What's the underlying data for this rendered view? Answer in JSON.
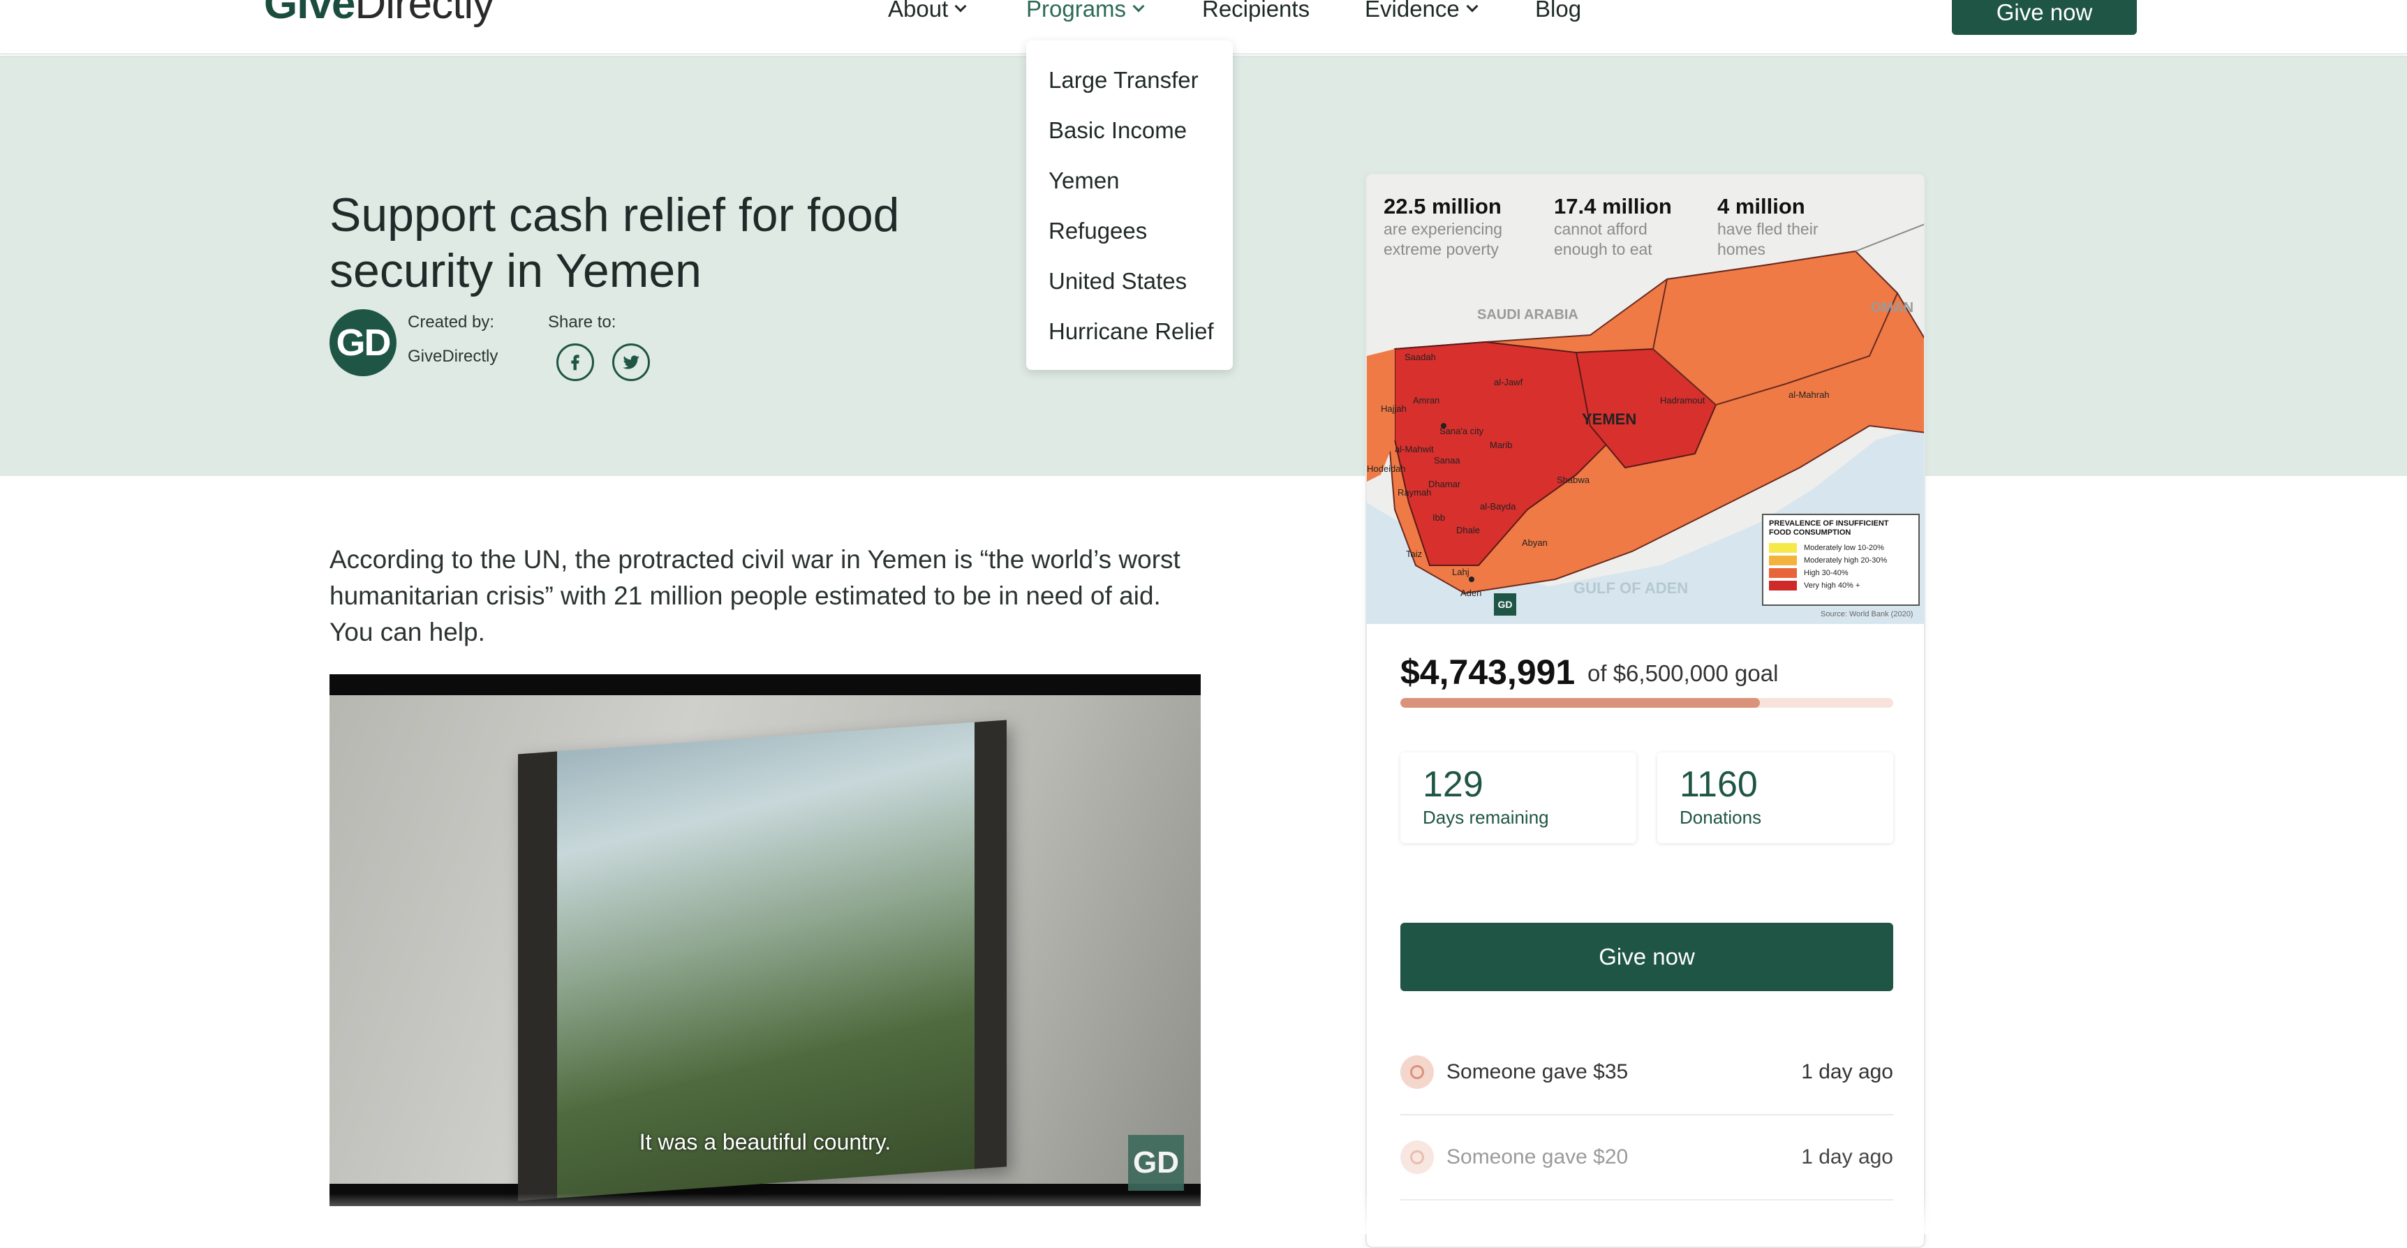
{
  "brand": {
    "logo_bold": "Give",
    "logo_rest": "Directly"
  },
  "nav": {
    "items": [
      {
        "label": "About",
        "has_dropdown": true
      },
      {
        "label": "Programs",
        "has_dropdown": true,
        "active": true
      },
      {
        "label": "Recipients",
        "has_dropdown": false
      },
      {
        "label": "Evidence",
        "has_dropdown": true
      },
      {
        "label": "Blog",
        "has_dropdown": false
      }
    ],
    "give_label": "Give now"
  },
  "programs_menu": [
    "Large Transfer",
    "Basic Income",
    "Yemen",
    "Refugees",
    "United States",
    "Hurricane Relief"
  ],
  "hero": {
    "title": "Support cash relief for food security in Yemen",
    "avatar_text": "GD",
    "created_label": "Created by:",
    "created_name": "GiveDirectly",
    "share_label": "Share to:"
  },
  "intro": "According to the UN, the protracted civil war in Yemen is “the world’s worst humanitarian crisis” with 21 million people estimated to be in need of aid. You can help.",
  "video": {
    "caption": "It was a beautiful country.",
    "badge": "GD"
  },
  "map": {
    "stats": [
      {
        "value": "22.5 million",
        "text": "are experiencing extreme poverty"
      },
      {
        "value": "17.4 million",
        "text": "cannot afford enough to eat"
      },
      {
        "value": "4 million",
        "text": "have fled their homes"
      }
    ],
    "labels": {
      "saudi": "SAUDI ARABIA",
      "oman": "OMAN",
      "yemen": "YEMEN",
      "gulf": "GULF OF ADEN",
      "regions": [
        "Saadah",
        "al-Jawf",
        "Amran",
        "Hajjah",
        "Sana'a city",
        "Marib",
        "al-Mahwit",
        "Sanaa",
        "Hodeidah",
        "Raymah",
        "Dhamar",
        "al-Bayda",
        "Ibb",
        "Dhale",
        "Taiz",
        "Lahj",
        "Aden",
        "Abyan",
        "Shabwa",
        "Hadramout",
        "al-Mahrah"
      ]
    },
    "legend_title": "PREVALENCE OF INSUFFICIENT FOOD CONSUMPTION",
    "legend": [
      {
        "label": "Moderately low 10-20%",
        "color": "#f5e94a"
      },
      {
        "label": "Moderately high 20-30%",
        "color": "#f2b23c"
      },
      {
        "label": "High 30-40%",
        "color": "#e8643a"
      },
      {
        "label": "Very high 40% +",
        "color": "#cf2a2a"
      }
    ],
    "source": "Source: World Bank (2020)",
    "badge": "GD"
  },
  "campaign": {
    "raised": "$4,743,991",
    "goal_text": "of $6,500,000 goal",
    "progress_fraction": 0.73,
    "days_value": "129",
    "days_label": "Days remaining",
    "donations_value": "1160",
    "donations_label": "Donations",
    "give_label": "Give now"
  },
  "donations": [
    {
      "text": "Someone gave $35",
      "time": "1 day ago"
    },
    {
      "text": "Someone gave $20",
      "time": "1 day ago"
    }
  ],
  "colors": {
    "brand_green": "#1f5545",
    "hero_bg": "#dfeae5",
    "progress_fill": "#d9937a",
    "progress_track": "#f7e3dc"
  }
}
